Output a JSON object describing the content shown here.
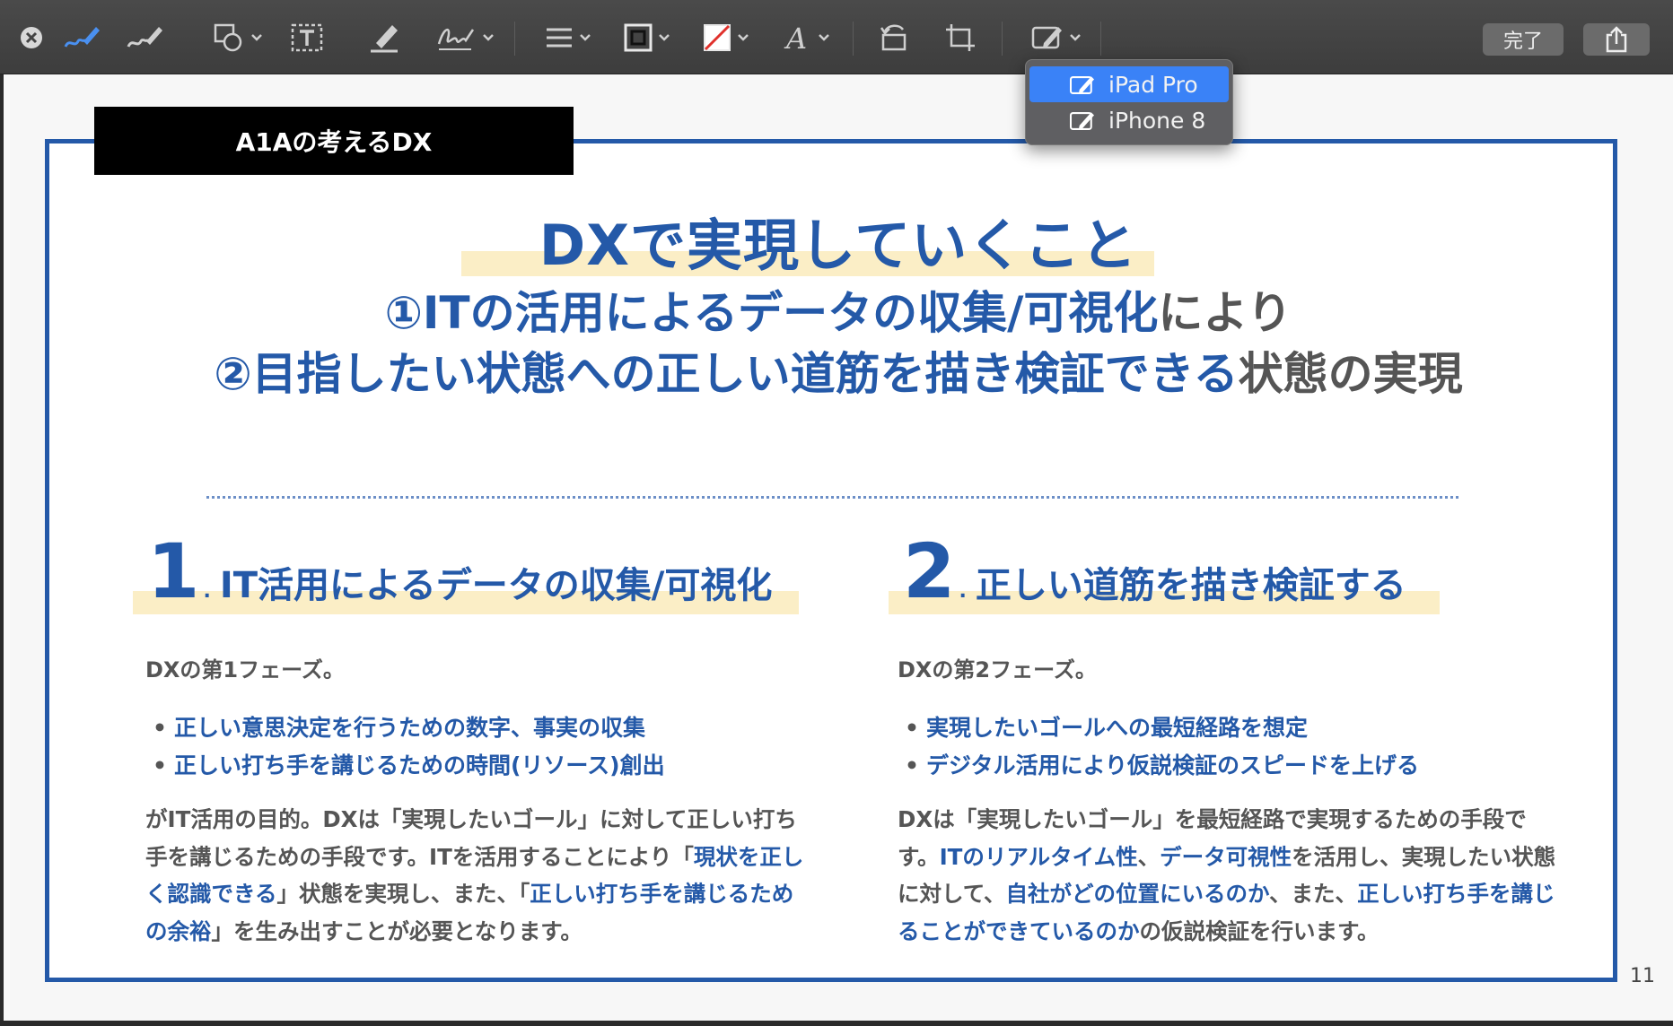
{
  "toolbar": {
    "tools": [
      "close-icon",
      "sketch-icon",
      "draw-icon",
      "shapes-icon",
      "text-box-icon",
      "highlight-icon",
      "sign-icon",
      "line-style-icon",
      "border-color-icon",
      "fill-color-icon",
      "text-style-icon",
      "rotate-icon",
      "crop-icon",
      "annotate-device-icon"
    ],
    "done_label": "完了"
  },
  "dropdown": {
    "items": [
      {
        "label": "iPad Pro",
        "selected": true
      },
      {
        "label": "iPhone 8",
        "selected": false
      }
    ]
  },
  "slide": {
    "tag": "A1Aの考えるDX",
    "title": "DXで実現していくこと",
    "sub1_blue": "①ITの活用によるデータの収集/可視化",
    "sub1_rest": "により",
    "sub2_blue": "②目指したい状態への正しい道筋を描き検証できる",
    "sub2_rest": "状態の実現",
    "col1": {
      "num": "1",
      "dot": ".",
      "heading": "IT活用によるデータの収集/可視化",
      "phase": "DXの第1フェーズ。",
      "bullets": [
        "正しい意思決定を行うための数字、事実の収集",
        "正しい打ち手を講じるための時間(リソース)創出"
      ],
      "p1": "がIT活用の目的。DXは「実現したいゴール」に対して正しい打ち手を講じるための手段です。ITを活用することにより「",
      "p2": "現状を正しく認識できる",
      "p3": "」状態を実現し、また、「",
      "p4": "正しい打ち手を講じるための余裕",
      "p5": "」を生み出すことが必要となります。"
    },
    "col2": {
      "num": "2",
      "dot": ".",
      "heading": "正しい道筋を描き検証する",
      "phase": "DXの第2フェーズ。",
      "bullets": [
        "実現したいゴールへの最短経路を想定",
        "デジタル活用により仮説検証のスピードを上げる"
      ],
      "p1": "DXは「実現したいゴール」を最短経路で実現するための手段です。",
      "p2": "ITのリアルタイム性",
      "p3": "、",
      "p4": "データ可視性",
      "p5": "を活用し、実現したい状態に対して、",
      "p6": "自社がどの位置にいるのか",
      "p7": "、また、",
      "p8": "正しい打ち手を講じることができているのか",
      "p9": "の仮説検証を行います。"
    },
    "page_number": "11"
  },
  "colors": {
    "accent": "#2459a8",
    "highlight": "#fbeec6",
    "selection": "#3a82f7"
  }
}
